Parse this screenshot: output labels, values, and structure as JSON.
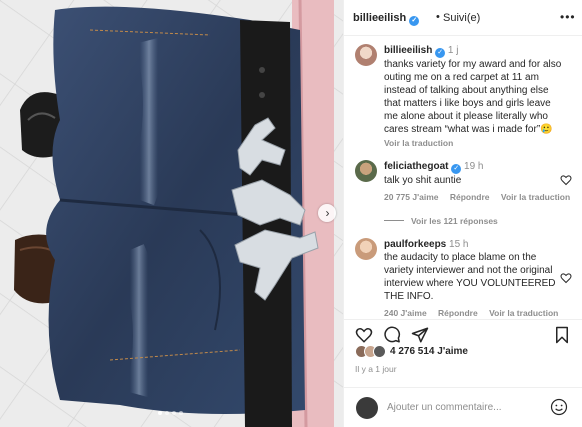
{
  "post": {
    "username": "billieeilish",
    "follow_label": "Suivi(e)",
    "more_label": "•••",
    "image_dots": 4
  },
  "caption": {
    "username": "billieeilish",
    "time": "1 j",
    "text": "thanks variety for my award and for also outing me on a red carpet at 11 am instead of talking about anything else that matters i like boys and girls leave me alone about it please literally who cares stream “what was i made for”🥲",
    "translate": "Voir la traduction"
  },
  "comments": [
    {
      "username": "feliciathegoat",
      "verified": true,
      "time": "19 h",
      "text": "talk yo shit auntie",
      "likes": "20 775 J'aime",
      "reply": "Répondre",
      "translate": "Voir la traduction",
      "replies": "Voir les 121 réponses"
    },
    {
      "username": "paulforkeeps",
      "time": "15 h",
      "text": "the audacity to place blame on the variety interviewer and not the original interview where YOU VOLUNTEERED THE INFO.",
      "likes": "240 J'aime",
      "reply": "Répondre",
      "translate": "Voir la traduction"
    }
  ],
  "likes_count": "4 276 514 J'aime",
  "posted_ago": "Il y a 1 jour",
  "add_comment_placeholder": "Ajouter un commentaire...",
  "icons": [
    "heart-icon",
    "comment-icon",
    "share-icon",
    "bookmark-icon",
    "emoji-icon",
    "chevron-right-icon",
    "verified-icon"
  ],
  "colors": {
    "verified": "#3897f0",
    "muted": "#8e8e8e",
    "text": "#262626",
    "denim": "#2b3b57"
  }
}
